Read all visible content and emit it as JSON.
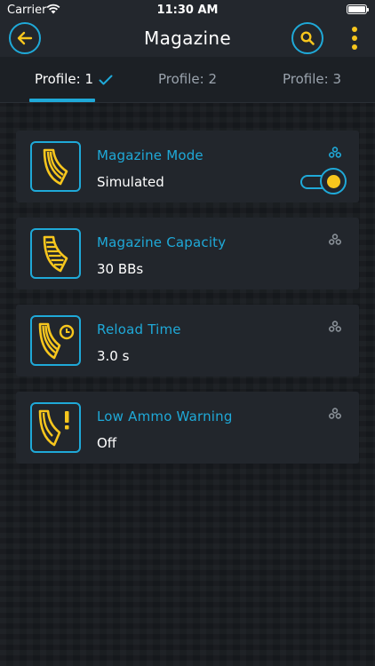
{
  "status_bar": {
    "carrier": "Carrier",
    "time": "11:30 AM"
  },
  "nav": {
    "title": "Magazine",
    "back_icon": "arrow-left-icon",
    "search_icon": "search-icon",
    "more_icon": "more-vertical-icon"
  },
  "tabs": [
    {
      "label": "Profile: 1",
      "selected": true
    },
    {
      "label": "Profile: 2",
      "selected": false
    },
    {
      "label": "Profile: 3",
      "selected": false
    }
  ],
  "settings": [
    {
      "title": "Magazine Mode",
      "value": "Simulated",
      "icon": "magazine-icon",
      "linked": true,
      "toggle_on": true
    },
    {
      "title": "Magazine Capacity",
      "value": "30 BBs",
      "icon": "magazine-capacity-icon",
      "linked": false
    },
    {
      "title": "Reload Time",
      "value": "3.0 s",
      "icon": "magazine-clock-icon",
      "linked": false
    },
    {
      "title": "Low Ammo Warning",
      "value": "Off",
      "icon": "magazine-warning-icon",
      "linked": false
    }
  ],
  "colors": {
    "accent": "#1fa9d8",
    "highlight": "#f7c61d",
    "card": "#22262c",
    "background": "#171a1e",
    "inactive_icon": "#8a9198"
  }
}
